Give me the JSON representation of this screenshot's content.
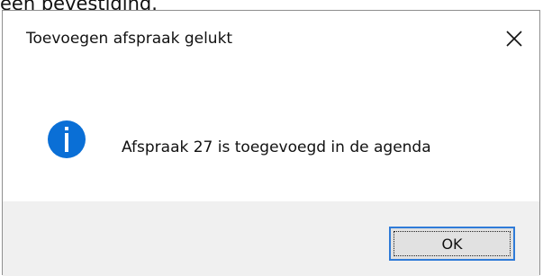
{
  "background_text": "een bevestiging.",
  "dialog": {
    "title": "Toevoegen afspraak gelukt",
    "message": "Afspraak 27 is toegevoegd in de agenda",
    "icon": "info-icon",
    "ok_label": "OK"
  },
  "colors": {
    "accent": "#0a6fd6",
    "button_border": "#2f7bd8",
    "footer": "#f0f0f0"
  }
}
